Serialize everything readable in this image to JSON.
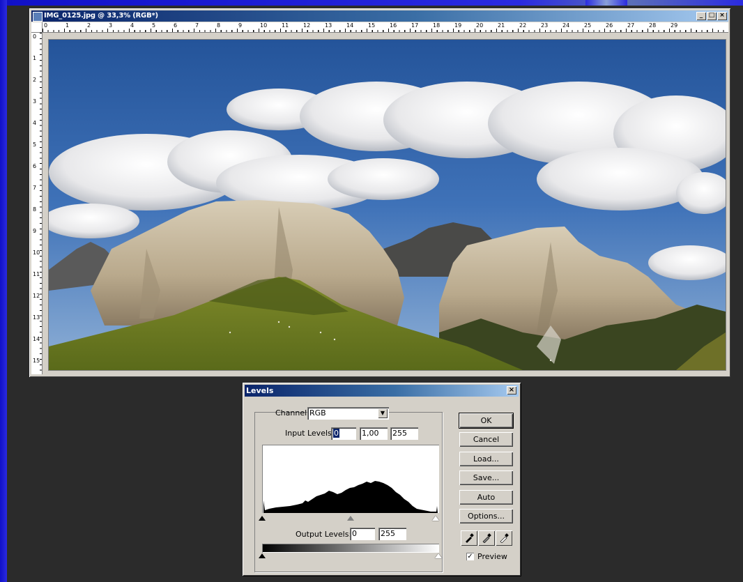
{
  "document": {
    "title": "IMG_0125.jpg @ 33,3% (RGB*)",
    "window_buttons": [
      "_",
      "□",
      "×"
    ],
    "ruler_h": [
      "0",
      "1",
      "2",
      "3",
      "4",
      "5",
      "6",
      "7",
      "8",
      "9",
      "10",
      "11",
      "12",
      "13",
      "14",
      "15",
      "16",
      "17",
      "18",
      "19",
      "20",
      "21",
      "22",
      "23",
      "24",
      "25",
      "26",
      "27",
      "28",
      "29"
    ],
    "ruler_v": [
      "0",
      "1",
      "2",
      "3",
      "4",
      "5",
      "6",
      "7",
      "8",
      "9",
      "10",
      "11",
      "12",
      "13",
      "14",
      "15"
    ]
  },
  "levels": {
    "title": "Levels",
    "close": "×",
    "channel_label": "Channel:",
    "channel_value": "RGB",
    "input_levels_label": "Input Levels:",
    "input_black": "0",
    "input_gamma": "1,00",
    "input_white": "255",
    "output_levels_label": "Output Levels:",
    "output_black": "0",
    "output_white": "255",
    "buttons": {
      "ok": "OK",
      "cancel": "Cancel",
      "load": "Load...",
      "save": "Save...",
      "auto": "Auto",
      "options": "Options..."
    },
    "preview_label": "Preview",
    "preview_checked": "✓"
  }
}
